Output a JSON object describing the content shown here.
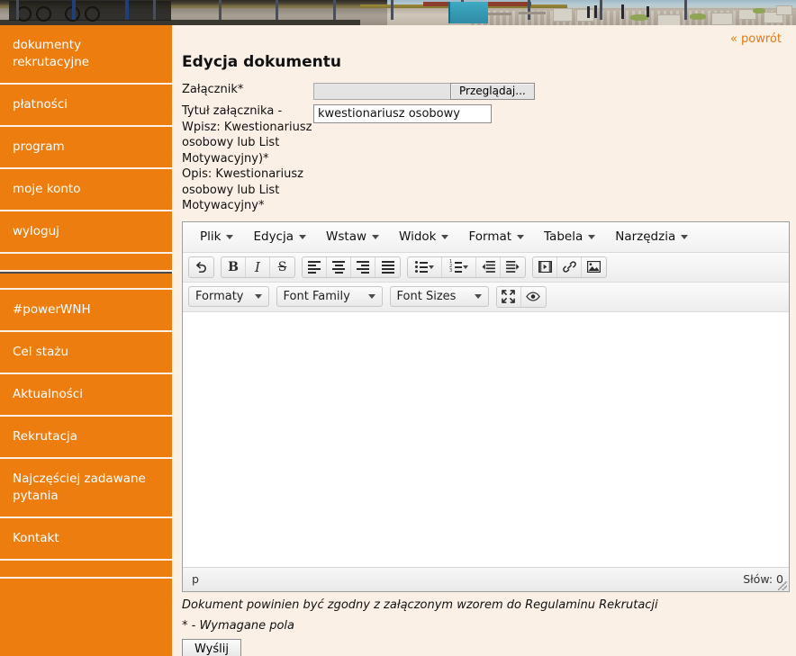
{
  "colors": {
    "accent_orange": "#ed7d0e",
    "page_background": "#faf0e6",
    "link_orange": "#e07a16",
    "nav_text": "#ffffff"
  },
  "sidebar": {
    "items": [
      {
        "label": "dokumenty rekrutacyjne",
        "type": "link"
      },
      {
        "label": "płatności",
        "type": "link"
      },
      {
        "label": "program",
        "type": "link"
      },
      {
        "label": "moje konto",
        "type": "link"
      },
      {
        "label": "wyloguj",
        "type": "link"
      },
      {
        "label": "",
        "type": "spacer"
      },
      {
        "label": "",
        "type": "spacer"
      },
      {
        "label": "#powerWNH",
        "type": "link"
      },
      {
        "label": "Cel stażu",
        "type": "link"
      },
      {
        "label": "Aktualności",
        "type": "link"
      },
      {
        "label": "Rekrutacja",
        "type": "link"
      },
      {
        "label": "Najczęściej zadawane pytania",
        "type": "link"
      },
      {
        "label": "Kontakt",
        "type": "link"
      },
      {
        "label": "",
        "type": "spacer"
      }
    ]
  },
  "main": {
    "back_link": "« powrót",
    "page_title": "Edycja dokumentu",
    "fields": {
      "attachment": {
        "label": "Załącznik*",
        "file_value": "",
        "browse_label": "Przeglądaj..."
      },
      "title": {
        "label": "Tytuł załącznika - Wpisz: Kwestionariusz osobowy lub List Motywacyjny)*",
        "value": "kwestionariusz osobowy",
        "placeholder": ""
      },
      "description": {
        "label": "Opis: Kwestionariusz osobowy lub List Motywacyjny*"
      }
    },
    "footnote_line1": "Dokument powinien być zgodny z załączonym wzorem do Regulaminu Rekrutacji",
    "footnote_line2": "* - Wymagane pola",
    "submit_label": "Wyślij"
  },
  "editor": {
    "menus": [
      {
        "label": "Plik"
      },
      {
        "label": "Edycja"
      },
      {
        "label": "Wstaw"
      },
      {
        "label": "Widok"
      },
      {
        "label": "Format"
      },
      {
        "label": "Tabela"
      },
      {
        "label": "Narzędzia"
      }
    ],
    "toolbar_row1": [
      {
        "name": "undo-icon",
        "title": "Cofnij"
      },
      {
        "name": "bold-icon",
        "title": "Pogrubienie",
        "glyph": "B"
      },
      {
        "name": "italic-icon",
        "title": "Kursywa",
        "glyph": "I"
      },
      {
        "name": "strikethrough-icon",
        "title": "Przekreślenie",
        "glyph": "S"
      },
      {
        "name": "align-left-icon",
        "title": "Wyrównaj do lewej"
      },
      {
        "name": "align-center-icon",
        "title": "Wyśrodkuj"
      },
      {
        "name": "align-right-icon",
        "title": "Wyrównaj do prawej"
      },
      {
        "name": "align-justify-icon",
        "title": "Wyjustuj"
      },
      {
        "name": "bullet-list-icon",
        "title": "Lista punktowana"
      },
      {
        "name": "numbered-list-icon",
        "title": "Lista numerowana"
      },
      {
        "name": "outdent-icon",
        "title": "Zmniejsz wcięcie"
      },
      {
        "name": "indent-icon",
        "title": "Zwiększ wcięcie"
      },
      {
        "name": "media-icon",
        "title": "Wstaw multimedia"
      },
      {
        "name": "link-icon",
        "title": "Wstaw odnośnik"
      },
      {
        "name": "image-icon",
        "title": "Wstaw obraz"
      }
    ],
    "toolbar_row2": {
      "formaty_label": "Formaty",
      "font_family_label": "Font Family",
      "font_sizes_label": "Font Sizes",
      "fullscreen_icon": "fullscreen-icon",
      "preview_icon": "preview-eye-icon"
    },
    "content": "",
    "status_path": "p",
    "word_count": "Słów: 0"
  }
}
